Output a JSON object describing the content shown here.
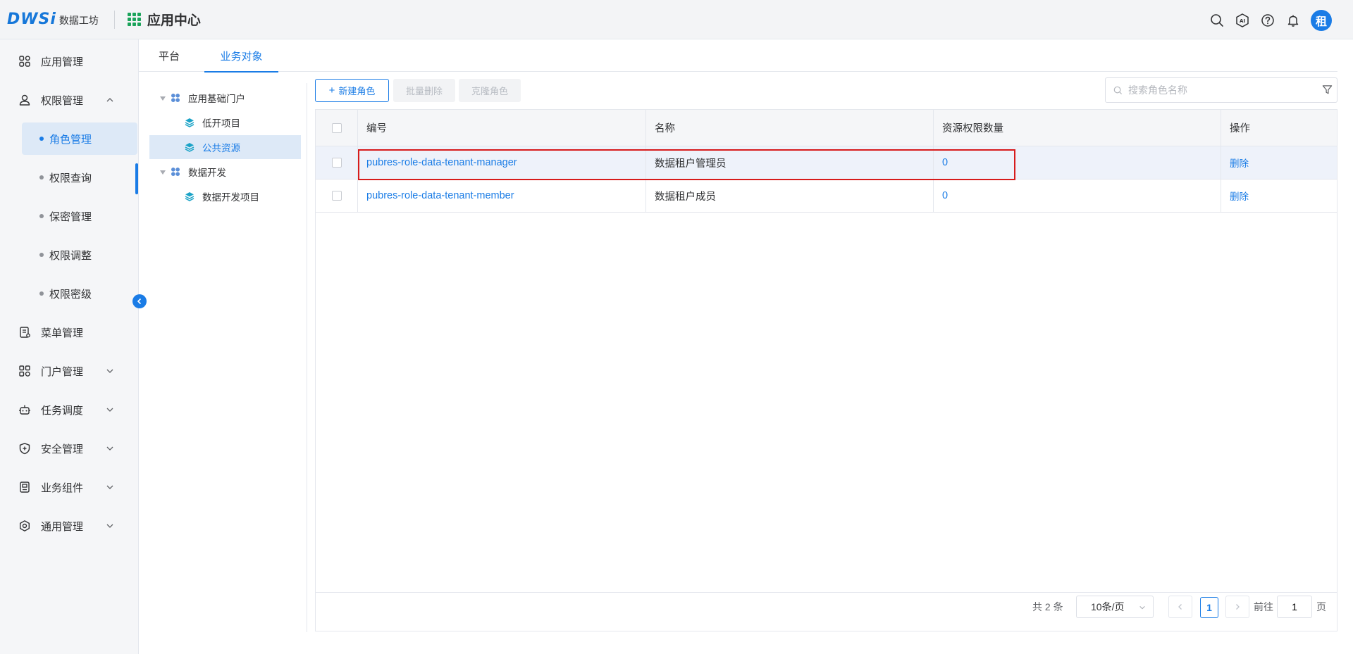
{
  "header": {
    "logo_text": "DWSi",
    "logo_subtitle": "数据工坊",
    "app_center_title": "应用中心",
    "avatar_text": "租",
    "accent_color": "#1a7ce6"
  },
  "sidebar": {
    "items": [
      {
        "label": "应用管理",
        "icon": "apps-icon"
      },
      {
        "label": "权限管理",
        "icon": "user-lock-icon",
        "expanded": true
      },
      {
        "label": "菜单管理",
        "icon": "menu-doc-icon"
      },
      {
        "label": "门户管理",
        "icon": "portal-icon"
      },
      {
        "label": "任务调度",
        "icon": "robot-icon"
      },
      {
        "label": "安全管理",
        "icon": "shield-icon"
      },
      {
        "label": "业务组件",
        "icon": "component-icon"
      },
      {
        "label": "通用管理",
        "icon": "settings-icon"
      }
    ],
    "sub_items": [
      {
        "label": "角色管理",
        "active": true
      },
      {
        "label": "权限查询"
      },
      {
        "label": "保密管理"
      },
      {
        "label": "权限调整"
      },
      {
        "label": "权限密级"
      }
    ]
  },
  "tabs": [
    {
      "label": "平台"
    },
    {
      "label": "业务对象",
      "active": true
    }
  ],
  "tree": {
    "nodes": [
      {
        "label": "应用基础门户",
        "level": 0,
        "icon": "group-icon"
      },
      {
        "label": "低开项目",
        "level": 1,
        "icon": "layers-icon"
      },
      {
        "label": "公共资源",
        "level": 1,
        "icon": "layers-icon",
        "selected": true
      },
      {
        "label": "数据开发",
        "level": 0,
        "icon": "group-icon"
      },
      {
        "label": "数据开发项目",
        "level": 1,
        "icon": "layers-icon"
      }
    ]
  },
  "toolbar": {
    "new_role": "新建角色",
    "batch_delete": "批量删除",
    "clone_role": "克隆角色",
    "search_placeholder": "搜索角色名称"
  },
  "table": {
    "columns": [
      "编号",
      "名称",
      "资源权限数量",
      "操作"
    ],
    "rows": [
      {
        "code": "pubres-role-data-tenant-manager",
        "name": "数据租户管理员",
        "count": "0",
        "action": "删除"
      },
      {
        "code": "pubres-role-data-tenant-member",
        "name": "数据租户成员",
        "count": "0",
        "action": "删除"
      }
    ]
  },
  "pagination": {
    "total_text": "共 2 条",
    "page_size": "10条/页",
    "current_page": "1",
    "goto_label": "前往",
    "goto_value": "1",
    "page_suffix": "页"
  }
}
